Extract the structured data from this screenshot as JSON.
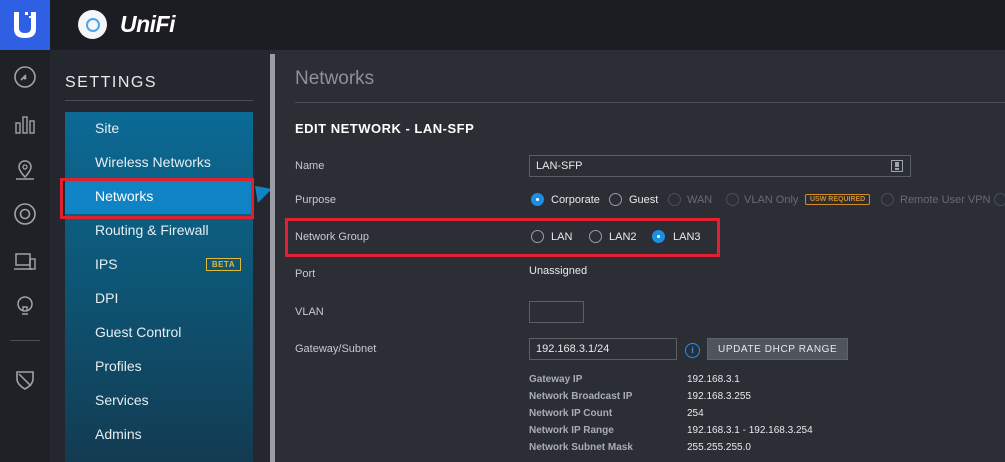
{
  "brand": {
    "name": "UniFi"
  },
  "settings": {
    "title": "SETTINGS",
    "items": [
      {
        "label": "Site"
      },
      {
        "label": "Wireless Networks"
      },
      {
        "label": "Networks"
      },
      {
        "label": "Routing & Firewall"
      },
      {
        "label": "IPS",
        "badge": "BETA"
      },
      {
        "label": "DPI"
      },
      {
        "label": "Guest Control"
      },
      {
        "label": "Profiles"
      },
      {
        "label": "Services"
      },
      {
        "label": "Admins"
      }
    ],
    "active": "Networks"
  },
  "main": {
    "title": "Networks",
    "section": "EDIT NETWORK - LAN-SFP",
    "name": {
      "label": "Name",
      "value": "LAN-SFP"
    },
    "purpose": {
      "label": "Purpose",
      "options": [
        {
          "label": "Corporate",
          "selected": true
        },
        {
          "label": "Guest"
        },
        {
          "label": "WAN"
        },
        {
          "label": "VLAN Only"
        },
        {
          "label": "Remote User VPN"
        }
      ],
      "usw_badge": "USW REQUIRED"
    },
    "network_group": {
      "label": "Network Group",
      "options": [
        {
          "label": "LAN"
        },
        {
          "label": "LAN2"
        },
        {
          "label": "LAN3",
          "selected": true
        }
      ]
    },
    "port": {
      "label": "Port",
      "value": "Unassigned"
    },
    "vlan": {
      "label": "VLAN",
      "value": ""
    },
    "gateway": {
      "label": "Gateway/Subnet",
      "value": "192.168.3.1/24",
      "info": "i",
      "button": "UPDATE DHCP RANGE"
    },
    "details": [
      {
        "key": "Gateway IP",
        "value": "192.168.3.1"
      },
      {
        "key": "Network Broadcast IP",
        "value": "192.168.3.255"
      },
      {
        "key": "Network IP Count",
        "value": "254"
      },
      {
        "key": "Network IP Range",
        "value": "192.168.3.1 - 192.168.3.254"
      },
      {
        "key": "Network Subnet Mask",
        "value": "255.255.255.0"
      }
    ]
  },
  "colors": {
    "accent": "#1c8fe3",
    "highlight": "#e0222e",
    "active_menu": "#0f83c4"
  }
}
